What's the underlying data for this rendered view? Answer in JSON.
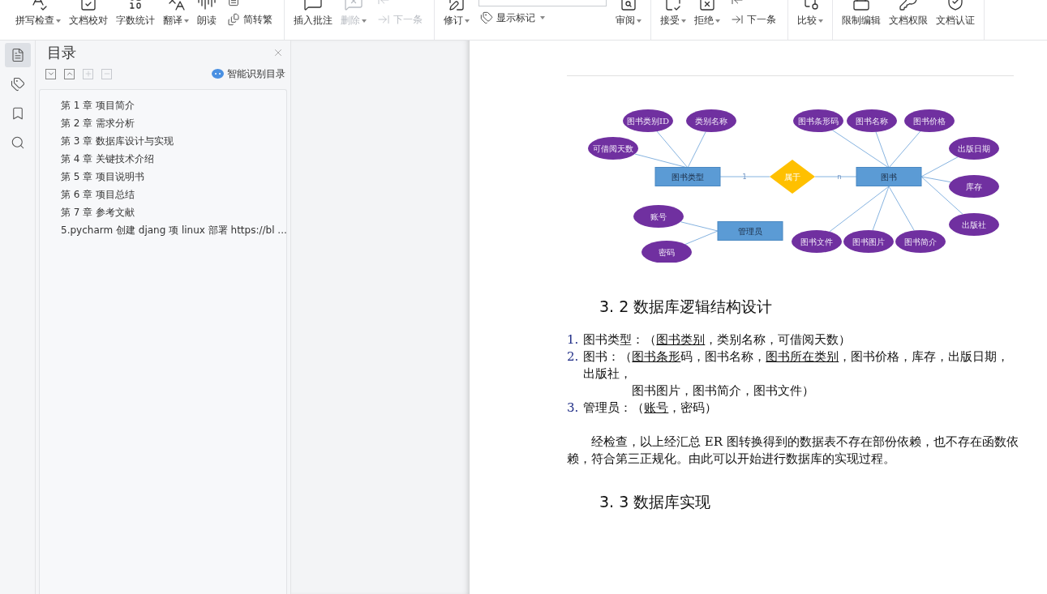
{
  "toolbar": {
    "groups": [
      {
        "items": [
          {
            "kind": "large",
            "label": "拼写检查",
            "menu": true,
            "disabled": false
          },
          {
            "kind": "large",
            "label": "文档校对",
            "menu": false,
            "disabled": false
          },
          {
            "kind": "large",
            "label": "字数统计",
            "menu": false,
            "disabled": false
          },
          {
            "kind": "large",
            "label": "翻译",
            "menu": true,
            "disabled": false
          },
          {
            "kind": "large",
            "label": "朗读",
            "menu": false,
            "disabled": false
          },
          {
            "kind": "stack",
            "rows": [
              {
                "disabled": false
              },
              {
                "label": "简转繁",
                "disabled": false
              }
            ]
          }
        ]
      },
      {
        "items": [
          {
            "kind": "large",
            "label": "插入批注",
            "menu": false,
            "disabled": false
          },
          {
            "kind": "large",
            "label": "删除",
            "menu": true,
            "disabled": true
          },
          {
            "kind": "stack",
            "rows": [
              {
                "disabled": true
              },
              {
                "label": "下一条",
                "disabled": true
              }
            ]
          }
        ]
      },
      {
        "items": [
          {
            "kind": "large",
            "label": "修订",
            "menu": true,
            "disabled": false
          },
          {
            "kind": "select",
            "label": "显示标记"
          },
          {
            "kind": "large",
            "label": "审阅",
            "menu": true,
            "disabled": false
          }
        ]
      },
      {
        "items": [
          {
            "kind": "large",
            "label": "接受",
            "menu": true,
            "disabled": false
          },
          {
            "kind": "large",
            "label": "拒绝",
            "menu": true,
            "disabled": false
          },
          {
            "kind": "stack",
            "rows": [
              {
                "disabled": false
              },
              {
                "label": "下一条",
                "disabled": false
              }
            ]
          }
        ]
      },
      {
        "items": [
          {
            "kind": "large",
            "label": "比较",
            "menu": true,
            "disabled": false
          }
        ]
      },
      {
        "items": [
          {
            "kind": "large",
            "label": "限制编辑",
            "menu": false,
            "disabled": false
          },
          {
            "kind": "large",
            "label": "文档权限",
            "menu": false,
            "disabled": false
          },
          {
            "kind": "large",
            "label": "文档认证",
            "menu": false,
            "disabled": false
          }
        ]
      }
    ]
  },
  "side_tabs": [
    {
      "selected": true
    },
    {
      "selected": false
    },
    {
      "selected": false
    },
    {
      "selected": false
    }
  ],
  "toc_panel": {
    "title": "目录",
    "smart_button": "智能识别目录",
    "items": [
      "第 1 章  项目简介",
      "第 2 章  需求分析",
      "第 3 章  数据库设计与实现",
      "第 4 章  关键技术介绍",
      "第 5 章  项目说明书",
      "第 6 章  项目总结",
      "第 7 章  参考文献",
      "5.pycharm 创建 djang 项 linux 部署 https://bl ..."
    ]
  },
  "document": {
    "er_diagram": {
      "entities": [
        {
          "label": "图书类型",
          "attributes": [
            "图书类别ID",
            "类别名称",
            "可借阅天数"
          ]
        },
        {
          "label": "图书",
          "attributes": [
            "图书条形码",
            "图书名称",
            "图书价格",
            "出版日期",
            "库存",
            "出版社",
            "图书文件",
            "图书图片",
            "图书简介"
          ]
        },
        {
          "label": "管理员",
          "attributes": [
            "账号",
            "密码"
          ]
        }
      ],
      "relationship": {
        "label": "属于",
        "left_cardinality": "1",
        "right_cardinality": "n"
      }
    },
    "heading_1": "3. 2 数据库逻辑结构设计",
    "list": [
      {
        "number": "1.",
        "parts": [
          {
            "text": "图书类型：（",
            "underline": false
          },
          {
            "text": "图书类别",
            "underline": true
          },
          {
            "text": "，类别名称，可借阅天数）",
            "underline": false
          }
        ]
      },
      {
        "number": "2.",
        "parts": [
          {
            "text": "图书：（",
            "underline": false
          },
          {
            "text": "图书条形",
            "underline": true
          },
          {
            "text": "码，图书名称，",
            "underline": false
          },
          {
            "text": "图书所在类别",
            "underline": true
          },
          {
            "text": "，图书价格，库存，出版日期，出版社，",
            "underline": false
          }
        ],
        "continuation": "图书图片，图书简介，图书文件）"
      },
      {
        "number": "3.",
        "parts": [
          {
            "text": "管理员：（",
            "underline": false
          },
          {
            "text": "账号",
            "underline": true
          },
          {
            "text": "，密码）",
            "underline": false
          }
        ]
      }
    ],
    "paragraph": "经检查，以上经汇总 ER 图转换得到的数据表不存在部份依赖，也不存在函数依赖，符合第三正规化。由此可以开始进行数据库的实现过程。",
    "heading_2": "3. 3 数据库实现"
  }
}
